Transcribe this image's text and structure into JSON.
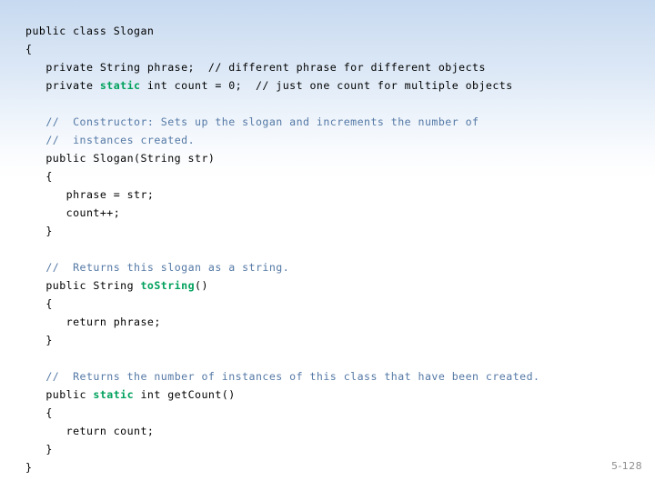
{
  "slide": {
    "page_number": "5-128",
    "background_top_color": "#c6d9f0",
    "background_bottom_color": "#ffffff",
    "doc_comment_color": "#5579a6",
    "keyword_color": "#00a15c",
    "code_color": "#000000",
    "page_number_color": "#8d8d8d"
  },
  "code": {
    "language": "java",
    "class_name": "Slogan",
    "full_text": "public class Slogan\n{\n   private String phrase;  // different phrase for different objects\n   private static int count = 0;  // just one count for multiple objects\n\n   //  Constructor: Sets up the slogan and increments the number of\n   //  instances created.\n   public Slogan(String str)\n   {\n      phrase = str;\n      count++;\n   }\n\n   //  Returns this slogan as a string.\n   public String toString()\n   {\n      return phrase;\n   }\n\n   //  Returns the number of instances of this class that have been created.\n   public static int getCount()\n   {\n      return count;\n   }\n}",
    "lines": [
      {
        "id": "l01",
        "segments": [
          {
            "t": "public class Slogan",
            "s": "code"
          }
        ]
      },
      {
        "id": "l02",
        "segments": [
          {
            "t": "{",
            "s": "code"
          }
        ]
      },
      {
        "id": "l03",
        "segments": [
          {
            "t": "   private String phrase;  ",
            "s": "code"
          },
          {
            "t": "// different phrase for different objects",
            "s": "inline-comment"
          }
        ]
      },
      {
        "id": "l04",
        "segments": [
          {
            "t": "   private ",
            "s": "code"
          },
          {
            "t": "static",
            "s": "key"
          },
          {
            "t": " int count = 0;  ",
            "s": "code"
          },
          {
            "t": "// just one count for multiple objects",
            "s": "inline-comment"
          }
        ]
      },
      {
        "id": "l05",
        "blank": true,
        "segments": []
      },
      {
        "id": "l06",
        "segments": [
          {
            "t": "   ",
            "s": "code"
          },
          {
            "t": "//  Constructor: Sets up the slogan and increments the number of",
            "s": "doc"
          }
        ]
      },
      {
        "id": "l07",
        "segments": [
          {
            "t": "   ",
            "s": "code"
          },
          {
            "t": "//  instances created.",
            "s": "doc"
          }
        ]
      },
      {
        "id": "l08",
        "segments": [
          {
            "t": "   public Slogan(String str)",
            "s": "code"
          }
        ]
      },
      {
        "id": "l09",
        "segments": [
          {
            "t": "   {",
            "s": "code"
          }
        ]
      },
      {
        "id": "l10",
        "segments": [
          {
            "t": "      phrase = str;",
            "s": "code"
          }
        ]
      },
      {
        "id": "l11",
        "segments": [
          {
            "t": "      count++;",
            "s": "code"
          }
        ]
      },
      {
        "id": "l12",
        "segments": [
          {
            "t": "   }",
            "s": "code"
          }
        ]
      },
      {
        "id": "l13",
        "blank": true,
        "segments": []
      },
      {
        "id": "l14",
        "segments": [
          {
            "t": "   ",
            "s": "code"
          },
          {
            "t": "//  Returns this slogan as a string.",
            "s": "doc"
          }
        ]
      },
      {
        "id": "l15",
        "segments": [
          {
            "t": "   public String ",
            "s": "code"
          },
          {
            "t": "toString",
            "s": "key"
          },
          {
            "t": "()",
            "s": "code"
          }
        ]
      },
      {
        "id": "l16",
        "segments": [
          {
            "t": "   {",
            "s": "code"
          }
        ]
      },
      {
        "id": "l17",
        "segments": [
          {
            "t": "      return phrase;",
            "s": "code"
          }
        ]
      },
      {
        "id": "l18",
        "segments": [
          {
            "t": "   }",
            "s": "code"
          }
        ]
      },
      {
        "id": "l19",
        "blank": true,
        "segments": []
      },
      {
        "id": "l20",
        "segments": [
          {
            "t": "   ",
            "s": "code"
          },
          {
            "t": "//  Returns the number of instances of this class that have been created.",
            "s": "doc"
          }
        ]
      },
      {
        "id": "l21",
        "segments": [
          {
            "t": "   public ",
            "s": "code"
          },
          {
            "t": "static",
            "s": "key"
          },
          {
            "t": " int getCount()",
            "s": "code"
          }
        ]
      },
      {
        "id": "l22",
        "segments": [
          {
            "t": "   {",
            "s": "code"
          }
        ]
      },
      {
        "id": "l23",
        "segments": [
          {
            "t": "      return count;",
            "s": "code"
          }
        ]
      },
      {
        "id": "l24",
        "segments": [
          {
            "t": "   }",
            "s": "code"
          }
        ]
      },
      {
        "id": "l25",
        "segments": [
          {
            "t": "}",
            "s": "code"
          }
        ]
      }
    ]
  }
}
